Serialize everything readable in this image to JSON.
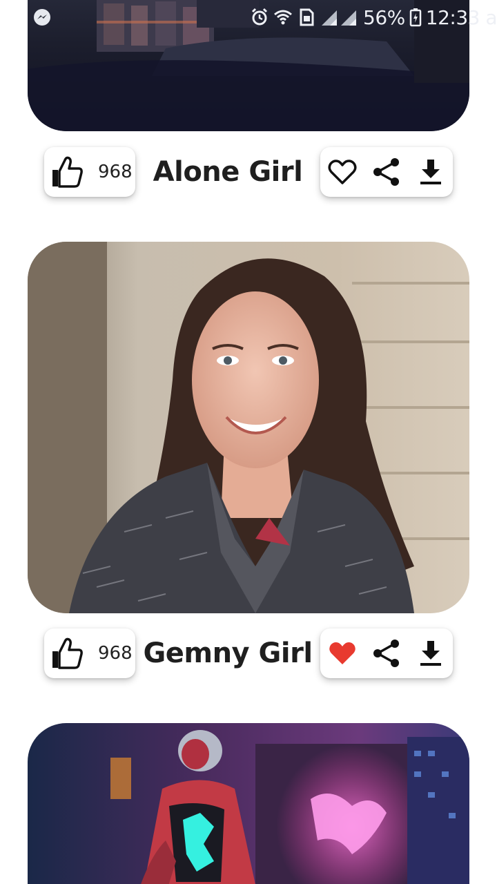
{
  "status_bar": {
    "battery": "56%",
    "time": "12:33 a",
    "icons": [
      "messenger-icon",
      "alarm-icon",
      "wifi-icon",
      "sim-icon",
      "signal-icon",
      "battery-charging-icon"
    ]
  },
  "feed": [
    {
      "title": "Alone Girl",
      "likes": "968",
      "favorited": false
    },
    {
      "title": "Gemny Girl",
      "likes": "968",
      "favorited": true
    }
  ],
  "colors": {
    "favorite_active": "#e83a2f",
    "icon": "#111111"
  }
}
